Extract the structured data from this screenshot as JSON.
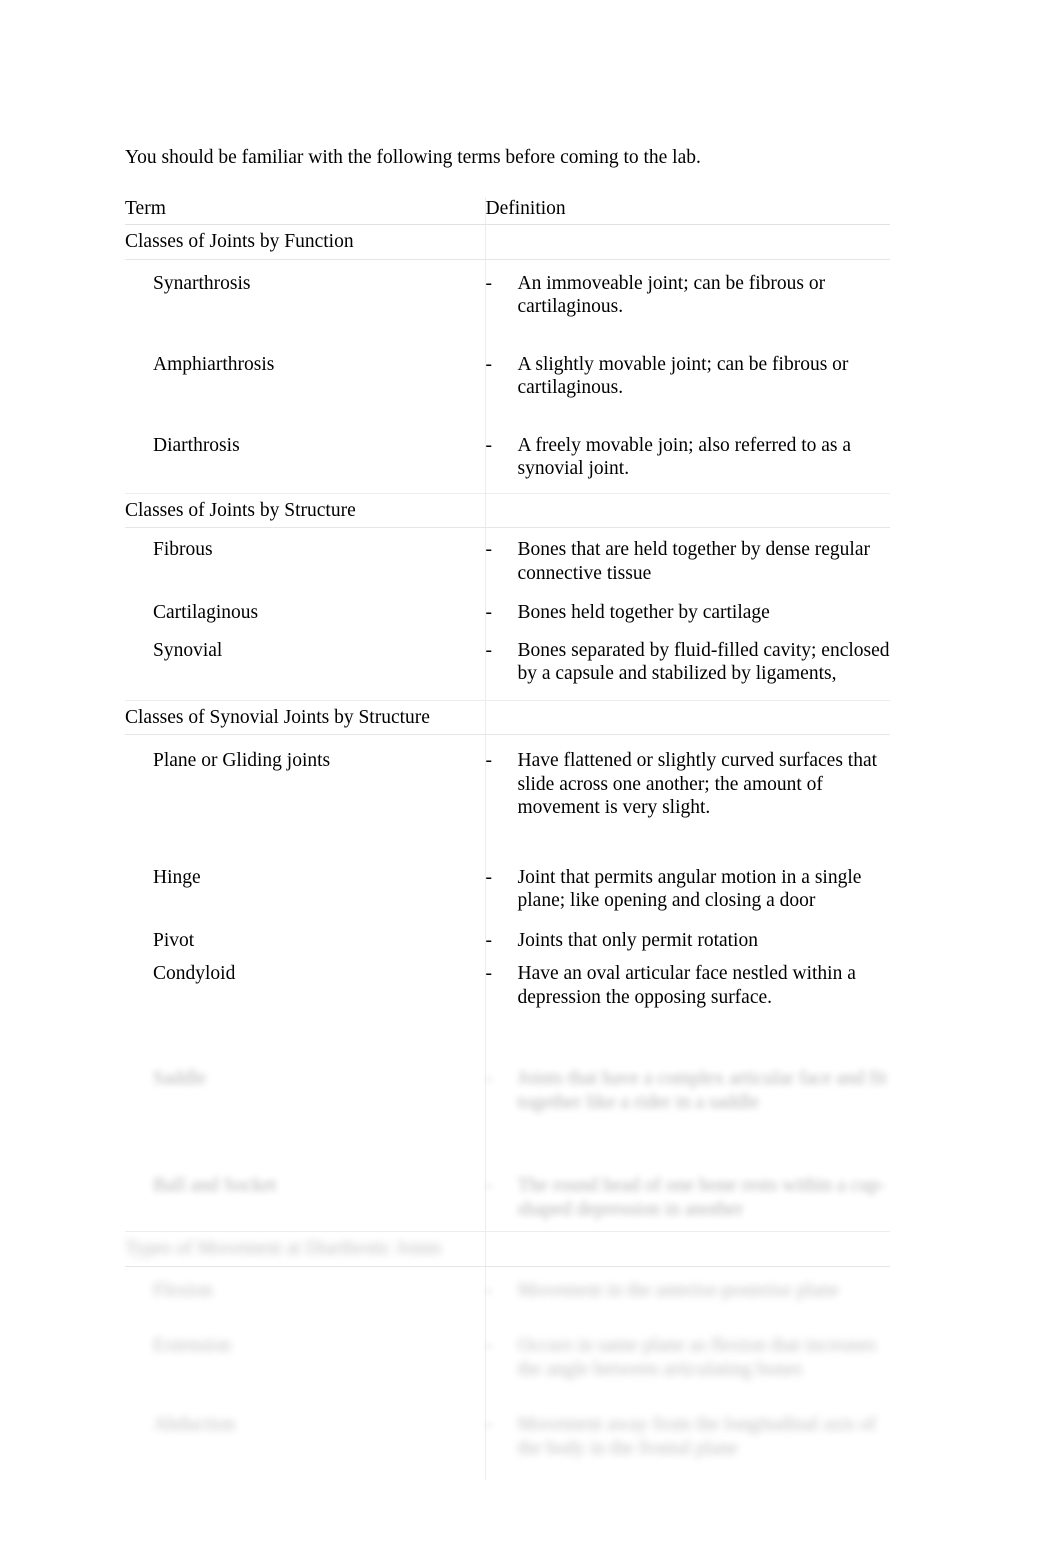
{
  "document": {
    "intro": "You should be familiar with the following terms before coming to the lab.",
    "columns": {
      "term": "Term",
      "definition": "Definition"
    },
    "sections": [
      {
        "title": "Classes of Joints by Function",
        "legible": true,
        "rows": [
          {
            "term": "Synarthrosis",
            "definitions": [
              "An immoveable joint; can be fibrous or cartilaginous."
            ]
          },
          {
            "term": "Amphiarthrosis",
            "definitions": [
              "A slightly movable joint; can be fibrous or cartilaginous."
            ]
          },
          {
            "term": "Diarthrosis",
            "definitions": [
              "A freely movable join; also referred to as a synovial joint."
            ]
          }
        ]
      },
      {
        "title": "Classes of Joints by Structure",
        "legible": true,
        "rows": [
          {
            "term": "Fibrous",
            "definitions": [
              "Bones that are held together by dense regular connective tissue"
            ]
          },
          {
            "term": "Cartilaginous",
            "definitions": [
              "Bones held together by cartilage"
            ]
          },
          {
            "term": "Synovial",
            "definitions": [
              "Bones separated by fluid-filled cavity; enclosed by a capsule and stabilized by ligaments,"
            ]
          }
        ]
      },
      {
        "title": "Classes of Synovial Joints by Structure",
        "legible": true,
        "rows": [
          {
            "term": "Plane or Gliding joints",
            "definitions": [
              "Have flattened or slightly curved surfaces that slide across one another; the amount of movement is very slight."
            ]
          },
          {
            "term": "Hinge",
            "definitions": [
              "Joint that permits angular motion in a single plane; like opening and closing a door"
            ]
          },
          {
            "term": "Pivot",
            "definitions": [
              "Joints that only permit rotation"
            ]
          },
          {
            "term": "Condyloid",
            "definitions": [
              "Have an oval articular face nestled within a depression the opposing surface."
            ]
          },
          {
            "term": "Saddle",
            "legible": false,
            "definitions": [
              "Joints that have a complex articular face and fit together like a rider in a saddle"
            ]
          },
          {
            "term": "Ball and Socket",
            "legible": false,
            "definitions": [
              "The round head of one bone rests within a cup-shaped depression in another"
            ]
          }
        ]
      },
      {
        "title": "Types of Movement at Diarthrotic Joints",
        "legible": false,
        "rows": [
          {
            "term": "Flexion",
            "legible": false,
            "definitions": [
              "Movement in the anterior-posterior plane"
            ]
          },
          {
            "term": "Extension",
            "legible": false,
            "definitions": [
              "Occurs in same plane as flexion that increases the angle between articulating bones"
            ]
          },
          {
            "term": "Abduction",
            "legible": false,
            "definitions": [
              "Movement away from the longitudinal axis of the body in the frontal plane"
            ]
          }
        ]
      }
    ]
  }
}
